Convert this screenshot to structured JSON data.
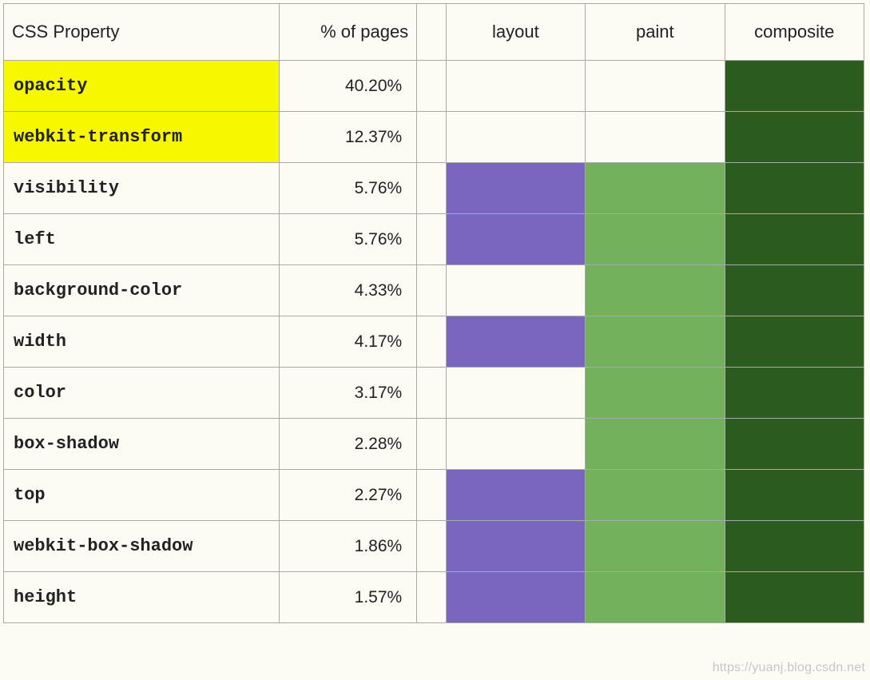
{
  "headers": {
    "property": "CSS Property",
    "percent": "% of pages",
    "layout": "layout",
    "paint": "paint",
    "composite": "composite"
  },
  "colors": {
    "layout": "#7966bf",
    "paint": "#73b15c",
    "composite": "#2c5b1e",
    "highlight": "#f7f700"
  },
  "rows": [
    {
      "property": "opacity",
      "percent": "40.20%",
      "highlight": true,
      "layout": false,
      "paint": false,
      "composite": true
    },
    {
      "property": "webkit-transform",
      "percent": "12.37%",
      "highlight": true,
      "layout": false,
      "paint": false,
      "composite": true
    },
    {
      "property": "visibility",
      "percent": "5.76%",
      "highlight": false,
      "layout": true,
      "paint": true,
      "composite": true
    },
    {
      "property": "left",
      "percent": "5.76%",
      "highlight": false,
      "layout": true,
      "paint": true,
      "composite": true
    },
    {
      "property": "background-color",
      "percent": "4.33%",
      "highlight": false,
      "layout": false,
      "paint": true,
      "composite": true
    },
    {
      "property": "width",
      "percent": "4.17%",
      "highlight": false,
      "layout": true,
      "paint": true,
      "composite": true
    },
    {
      "property": "color",
      "percent": "3.17%",
      "highlight": false,
      "layout": false,
      "paint": true,
      "composite": true
    },
    {
      "property": "box-shadow",
      "percent": "2.28%",
      "highlight": false,
      "layout": false,
      "paint": true,
      "composite": true
    },
    {
      "property": "top",
      "percent": "2.27%",
      "highlight": false,
      "layout": true,
      "paint": true,
      "composite": true
    },
    {
      "property": "webkit-box-shadow",
      "percent": "1.86%",
      "highlight": false,
      "layout": true,
      "paint": true,
      "composite": true
    },
    {
      "property": "height",
      "percent": "1.57%",
      "highlight": false,
      "layout": true,
      "paint": true,
      "composite": true
    }
  ],
  "watermark": "https://yuanj.blog.csdn.net",
  "chart_data": {
    "type": "table",
    "title": "CSS properties by % of pages and rendering pipeline stages triggered",
    "columns": [
      "CSS Property",
      "% of pages",
      "layout",
      "paint",
      "composite"
    ],
    "categories": [
      "opacity",
      "webkit-transform",
      "visibility",
      "left",
      "background-color",
      "width",
      "color",
      "box-shadow",
      "top",
      "webkit-box-shadow",
      "height"
    ],
    "series": [
      {
        "name": "% of pages",
        "values": [
          40.2,
          12.37,
          5.76,
          5.76,
          4.33,
          4.17,
          3.17,
          2.28,
          2.27,
          1.86,
          1.57
        ]
      },
      {
        "name": "layout",
        "values": [
          0,
          0,
          1,
          1,
          0,
          1,
          0,
          0,
          1,
          1,
          1
        ]
      },
      {
        "name": "paint",
        "values": [
          0,
          0,
          1,
          1,
          1,
          1,
          1,
          1,
          1,
          1,
          1
        ]
      },
      {
        "name": "composite",
        "values": [
          1,
          1,
          1,
          1,
          1,
          1,
          1,
          1,
          1,
          1,
          1
        ]
      }
    ],
    "highlighted_rows": [
      "opacity",
      "webkit-transform"
    ],
    "ylim": [
      0,
      100
    ]
  }
}
